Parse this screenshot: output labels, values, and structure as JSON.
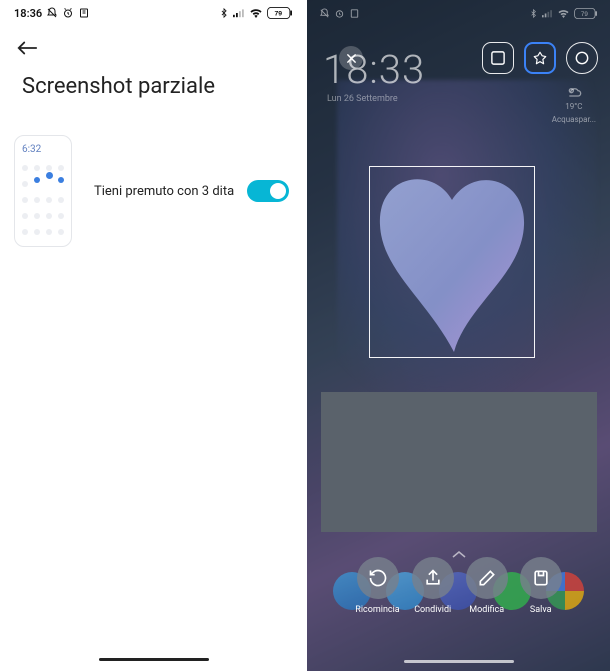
{
  "left": {
    "status": {
      "time": "18:36",
      "battery": "79"
    },
    "title": "Screenshot parziale",
    "thumb_time": "6:32",
    "setting_label": "Tieni premuto con 3 dita",
    "toggle_on": true
  },
  "right": {
    "status": {
      "battery": "79"
    },
    "lock_time": "18:33",
    "lock_date": "Lun 26 Settembre",
    "weather": {
      "loc": "Acquaspar...",
      "temp": "19°C"
    },
    "actions": [
      {
        "label": "Ricomincia"
      },
      {
        "label": "Condividi"
      },
      {
        "label": "Modifica"
      },
      {
        "label": "Salva"
      }
    ]
  }
}
